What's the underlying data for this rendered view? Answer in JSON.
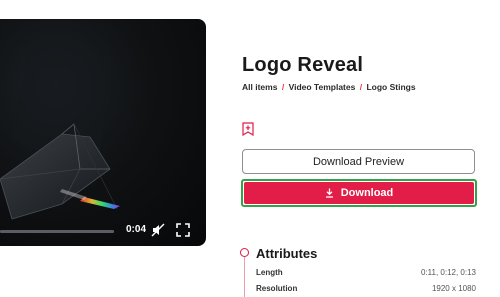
{
  "player": {
    "time": "0:04",
    "progress": 1.0
  },
  "item": {
    "title": "Logo Reveal",
    "breadcrumb": {
      "all_items": "All items",
      "sep1": "/",
      "category": "Video Templates",
      "sep2": "/",
      "subcategory": "Logo Stings"
    }
  },
  "actions": {
    "preview_label": "Download Preview",
    "download_label": "Download"
  },
  "attributes": {
    "heading": "Attributes",
    "rows": [
      {
        "key": "Length",
        "value": "0:11, 0:12, 0:13"
      },
      {
        "key": "Resolution",
        "value": "1920 x 1080"
      }
    ]
  },
  "colors": {
    "accent": "#e11d48",
    "focus_outline": "#36a04a"
  },
  "icons": [
    "mute-icon",
    "fullscreen-icon",
    "bookmark-add-icon",
    "download-icon"
  ]
}
